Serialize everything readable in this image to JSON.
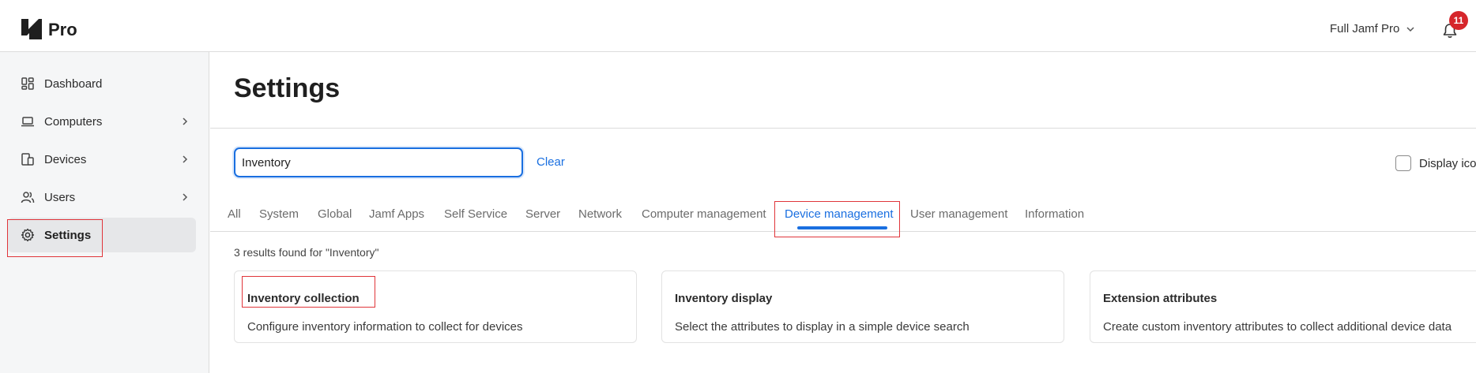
{
  "header": {
    "brand": "Pro",
    "environment": "Full Jamf Pro",
    "notifications_count": "11"
  },
  "sidebar": {
    "items": [
      {
        "label": "Dashboard",
        "icon": "dashboard-icon",
        "has_submenu": false
      },
      {
        "label": "Computers",
        "icon": "laptop-icon",
        "has_submenu": true
      },
      {
        "label": "Devices",
        "icon": "devices-icon",
        "has_submenu": true
      },
      {
        "label": "Users",
        "icon": "users-icon",
        "has_submenu": true
      },
      {
        "label": "Settings",
        "icon": "gear-icon",
        "has_submenu": false,
        "active": true
      }
    ]
  },
  "main": {
    "title": "Settings",
    "search": {
      "value": "Inventory",
      "placeholder": ""
    },
    "clear_label": "Clear",
    "display_icons_label": "Display icons",
    "tabs": [
      {
        "label": "All"
      },
      {
        "label": "System"
      },
      {
        "label": "Global"
      },
      {
        "label": "Jamf Apps"
      },
      {
        "label": "Self Service"
      },
      {
        "label": "Server"
      },
      {
        "label": "Network"
      },
      {
        "label": "Computer management"
      },
      {
        "label": "Device management",
        "active": true
      },
      {
        "label": "User management"
      },
      {
        "label": "Information"
      }
    ],
    "results_text": "3 results found for \"Inventory\"",
    "cards": [
      {
        "title": "Inventory collection",
        "description": "Configure inventory information to collect for devices"
      },
      {
        "title": "Inventory display",
        "description": "Select the attributes to display in a simple device search"
      },
      {
        "title": "Extension attributes",
        "description": "Create custom inventory attributes to collect additional device data"
      }
    ]
  },
  "colors": {
    "accent": "#1a6fe0",
    "badge": "#d6262b",
    "highlight": "#e0353a",
    "sidebar_bg": "#f5f6f7"
  }
}
